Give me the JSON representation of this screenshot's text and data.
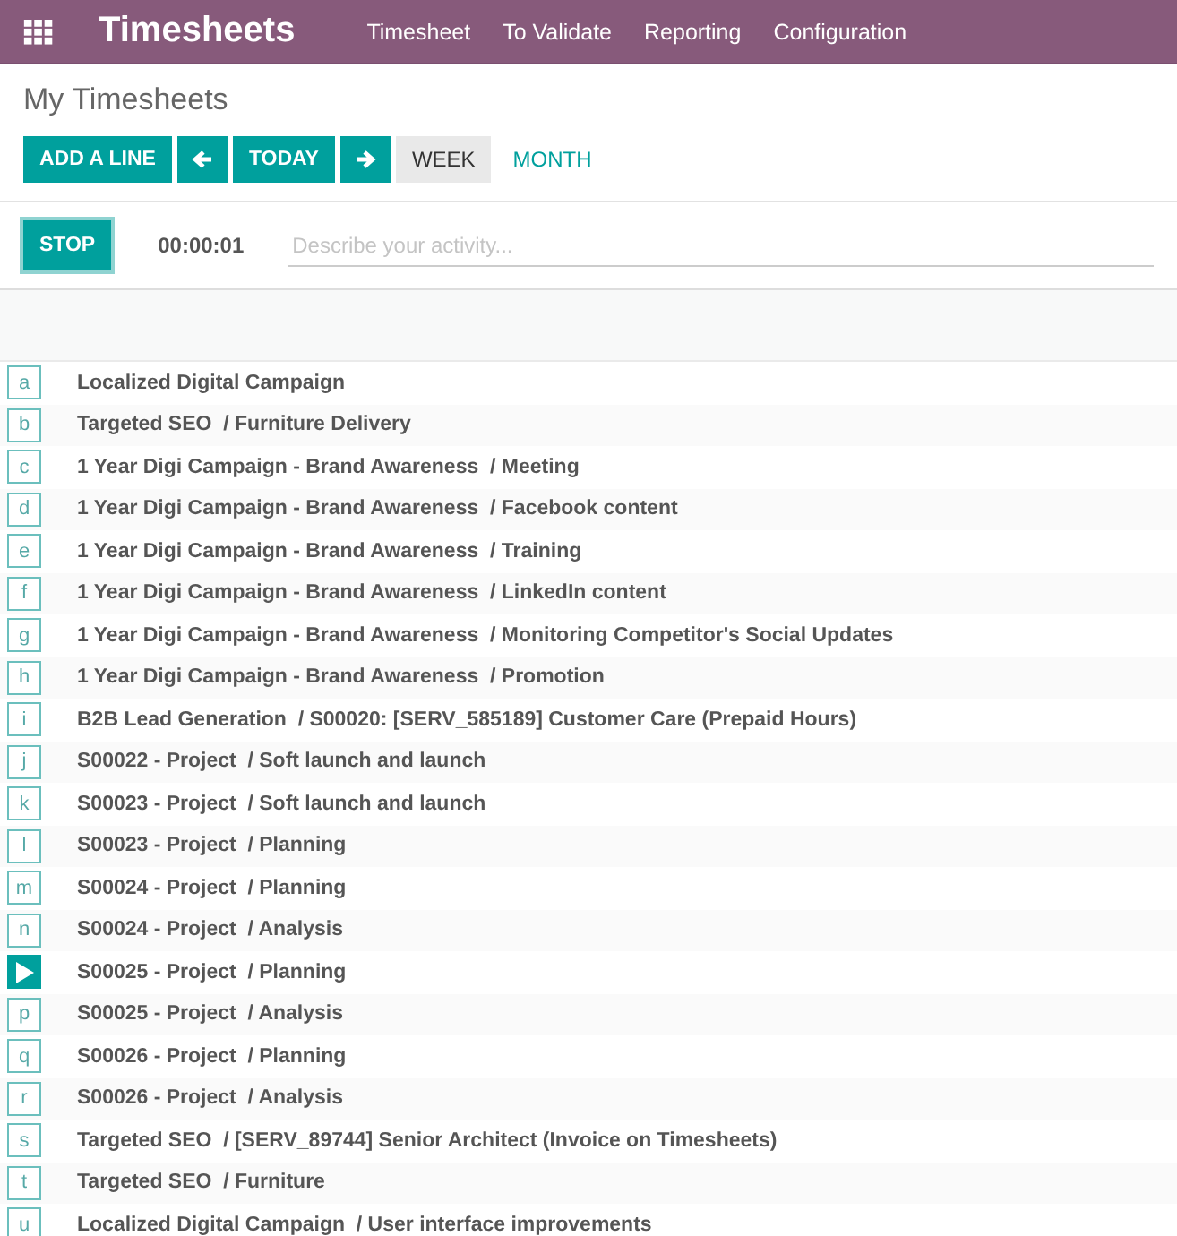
{
  "app": {
    "title": "Timesheets"
  },
  "menu": [
    "Timesheet",
    "To Validate",
    "Reporting",
    "Configuration"
  ],
  "page_title": "My Timesheets",
  "toolbar": {
    "add_label": "ADD A LINE",
    "today_label": "TODAY",
    "scales": [
      {
        "label": "WEEK",
        "selected": true
      },
      {
        "label": "MONTH",
        "selected": false
      }
    ]
  },
  "timer": {
    "button": "STOP",
    "elapsed": "00:00:01",
    "placeholder": "Describe your activity..."
  },
  "rows": [
    {
      "key": "a",
      "label": "Localized Digital Campaign",
      "running": false
    },
    {
      "key": "b",
      "label": "Targeted SEO  / Furniture Delivery",
      "running": false
    },
    {
      "key": "c",
      "label": "1 Year Digi Campaign - Brand Awareness  / Meeting",
      "running": false
    },
    {
      "key": "d",
      "label": "1 Year Digi Campaign - Brand Awareness  / Facebook content",
      "running": false
    },
    {
      "key": "e",
      "label": "1 Year Digi Campaign - Brand Awareness  / Training",
      "running": false
    },
    {
      "key": "f",
      "label": "1 Year Digi Campaign - Brand Awareness  / LinkedIn content",
      "running": false
    },
    {
      "key": "g",
      "label": "1 Year Digi Campaign - Brand Awareness  / Monitoring Competitor's Social Updates",
      "running": false
    },
    {
      "key": "h",
      "label": "1 Year Digi Campaign - Brand Awareness  / Promotion",
      "running": false
    },
    {
      "key": "i",
      "label": "B2B Lead Generation  / S00020: [SERV_585189] Customer Care (Prepaid Hours)",
      "running": false
    },
    {
      "key": "j",
      "label": "S00022 - Project  / Soft launch and launch",
      "running": false
    },
    {
      "key": "k",
      "label": "S00023 - Project  / Soft launch and launch",
      "running": false
    },
    {
      "key": "l",
      "label": "S00023 - Project  / Planning",
      "running": false
    },
    {
      "key": "m",
      "label": "S00024 - Project  / Planning",
      "running": false
    },
    {
      "key": "n",
      "label": "S00024 - Project  / Analysis",
      "running": false
    },
    {
      "label": "S00025 - Project  / Planning",
      "running": true
    },
    {
      "key": "p",
      "label": "S00025 - Project  / Analysis",
      "running": false
    },
    {
      "key": "q",
      "label": "S00026 - Project  / Planning",
      "running": false
    },
    {
      "key": "r",
      "label": "S00026 - Project  / Analysis",
      "running": false
    },
    {
      "key": "s",
      "label": "Targeted SEO  / [SERV_89744] Senior Architect (Invoice on Timesheets)",
      "running": false
    },
    {
      "key": "t",
      "label": "Targeted SEO  / Furniture",
      "running": false
    },
    {
      "key": "u",
      "label": "Localized Digital Campaign  / User interface improvements",
      "running": false
    }
  ]
}
